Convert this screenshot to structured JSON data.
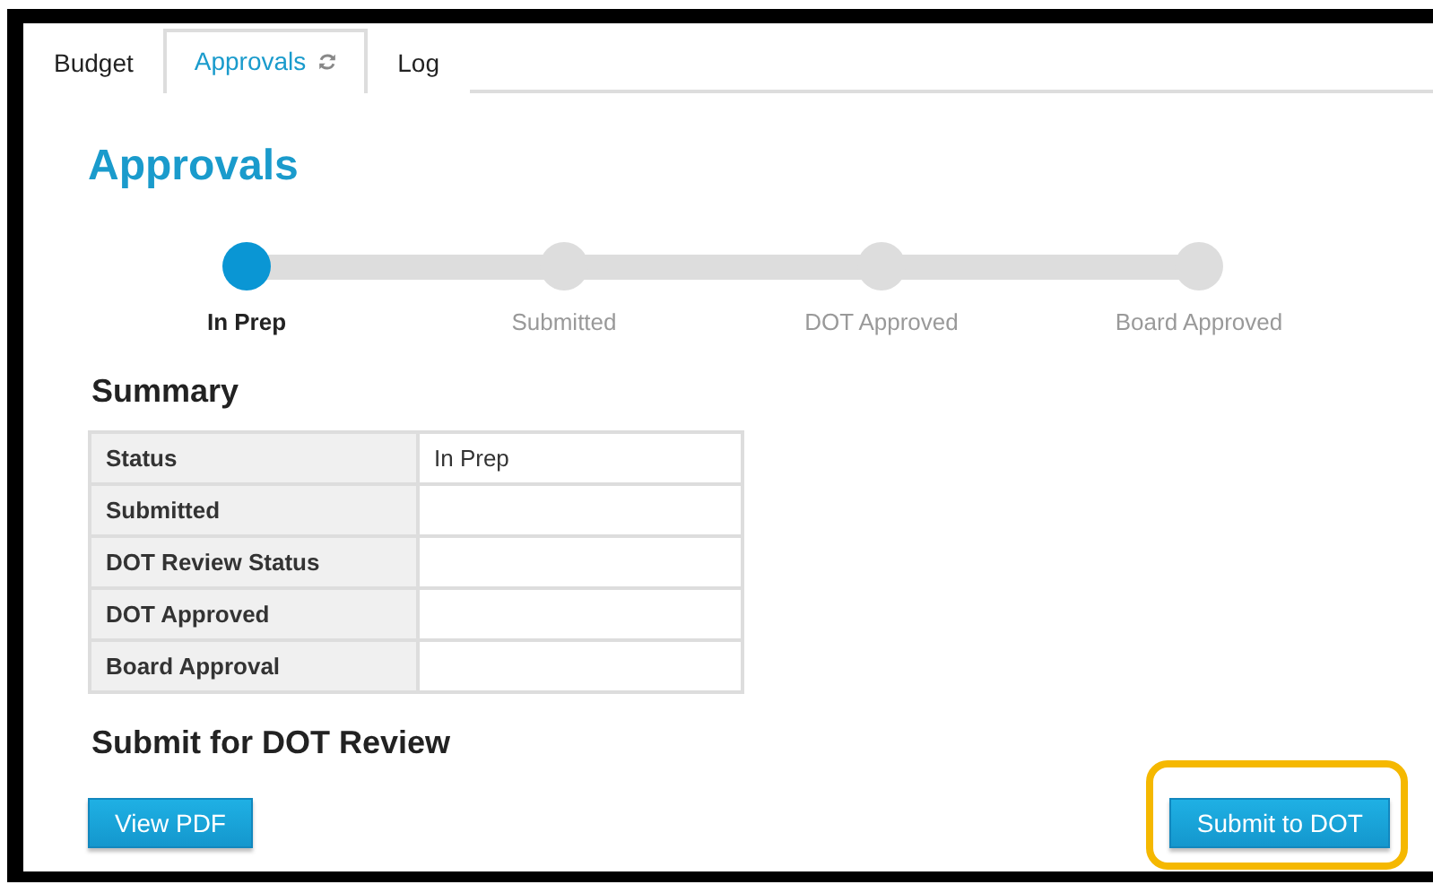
{
  "tabs": [
    {
      "label": "Budget",
      "selected": false,
      "refresh_icon": false
    },
    {
      "label": "Approvals",
      "selected": true,
      "refresh_icon": true
    },
    {
      "label": "Log",
      "selected": false,
      "refresh_icon": false
    }
  ],
  "heading": "Approvals",
  "steps": [
    {
      "label": "In Prep",
      "active": true
    },
    {
      "label": "Submitted",
      "active": false
    },
    {
      "label": "DOT Approved",
      "active": false
    },
    {
      "label": "Board Approved",
      "active": false
    }
  ],
  "summary": {
    "title": "Summary",
    "rows": [
      {
        "label": "Status",
        "value": "In Prep"
      },
      {
        "label": "Submitted"
      },
      {
        "label": "DOT Review Status"
      },
      {
        "label": "DOT Approved"
      },
      {
        "label": "Board Approval"
      }
    ]
  },
  "submit_section": {
    "title": "Submit for DOT Review",
    "buttons": [
      {
        "label": "View PDF",
        "highlighted": false
      },
      {
        "label": "Submit to DOT",
        "highlighted": true
      }
    ]
  }
}
